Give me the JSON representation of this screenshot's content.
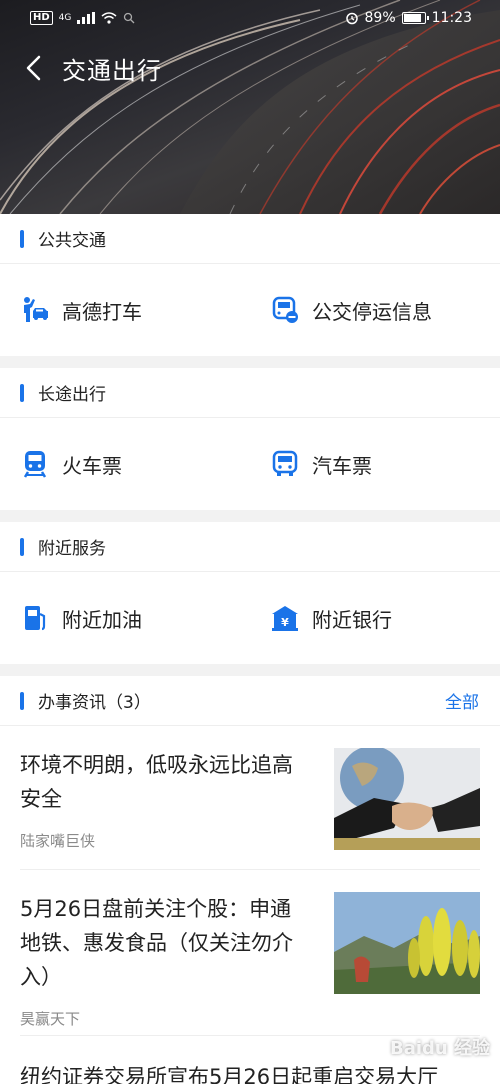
{
  "status": {
    "hd": "HD",
    "signal": "4G",
    "battery": "89%",
    "battery_level": 0.89,
    "time": "11:23"
  },
  "header": {
    "title": "交通出行"
  },
  "sections": [
    {
      "title": "公共交通",
      "items": [
        {
          "label": "高德打车",
          "icon": "taxi-hail-icon"
        },
        {
          "label": "公交停运信息",
          "icon": "bus-alert-icon"
        }
      ]
    },
    {
      "title": "长途出行",
      "items": [
        {
          "label": "火车票",
          "icon": "train-icon"
        },
        {
          "label": "汽车票",
          "icon": "coach-icon"
        }
      ]
    },
    {
      "title": "附近服务",
      "items": [
        {
          "label": "附近加油",
          "icon": "gas-station-icon"
        },
        {
          "label": "附近银行",
          "icon": "bank-icon"
        }
      ]
    }
  ],
  "news": {
    "title": "办事资讯（3）",
    "more": "全部",
    "items": [
      {
        "headline": "环境不明朗，低吸永远比追高安全",
        "source": "陆家嘴巨侠"
      },
      {
        "headline": "5月26日盘前关注个股：申通地铁、惠发食品（仅关注勿介入）",
        "source": "昊赢天下"
      },
      {
        "headline": "纽约证券交易所宣布5月26日起重启交易大厅"
      }
    ]
  },
  "watermark": "Baidu 经验",
  "colors": {
    "accent": "#1a73e8"
  }
}
